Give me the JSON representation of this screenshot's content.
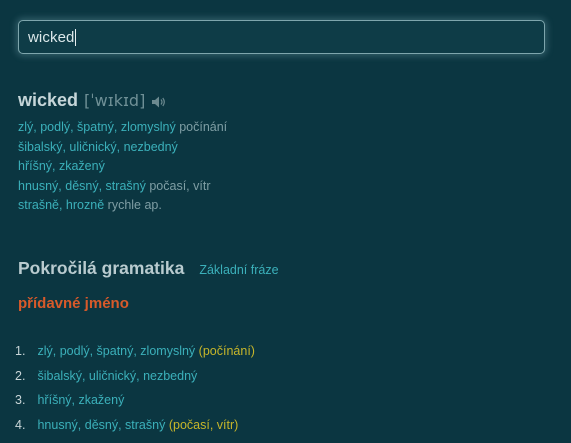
{
  "search": {
    "value": "wicked"
  },
  "entry": {
    "headword": "wicked",
    "ipa": "[ˈwɪkɪd]",
    "speaker_icon": "speaker-icon",
    "senses": [
      {
        "translations": "zlý, podlý, špatný, zlomyslný",
        "context": "počínání"
      },
      {
        "translations": "šibalský, uličnický, nezbedný",
        "context": ""
      },
      {
        "translations": "hříšný, zkažený",
        "context": ""
      },
      {
        "translations": "hnusný, děsný, strašný",
        "context": "počasí, vítr"
      },
      {
        "translations": "strašně, hrozně",
        "context": "rychle ap."
      }
    ]
  },
  "grammar": {
    "title": "Pokročilá gramatika",
    "link": "Základní fráze",
    "part_of_speech": "přídavné jméno",
    "items": [
      {
        "num": "1.",
        "translations": "zlý, podlý, špatný, zlomyslný",
        "context": "(počínání)"
      },
      {
        "num": "2.",
        "translations": "šibalský, uličnický, nezbedný",
        "context": ""
      },
      {
        "num": "3.",
        "translations": "hříšný, zkažený",
        "context": ""
      },
      {
        "num": "4.",
        "translations": "hnusný, děsný, strašný",
        "context": "(počasí, vítr)"
      }
    ]
  },
  "colors": {
    "background": "#0b3641",
    "translation": "#3bb0ba",
    "context": "#7f9ea4",
    "part_of_speech": "#d85a2a",
    "grammar_context": "#c7b62a"
  }
}
